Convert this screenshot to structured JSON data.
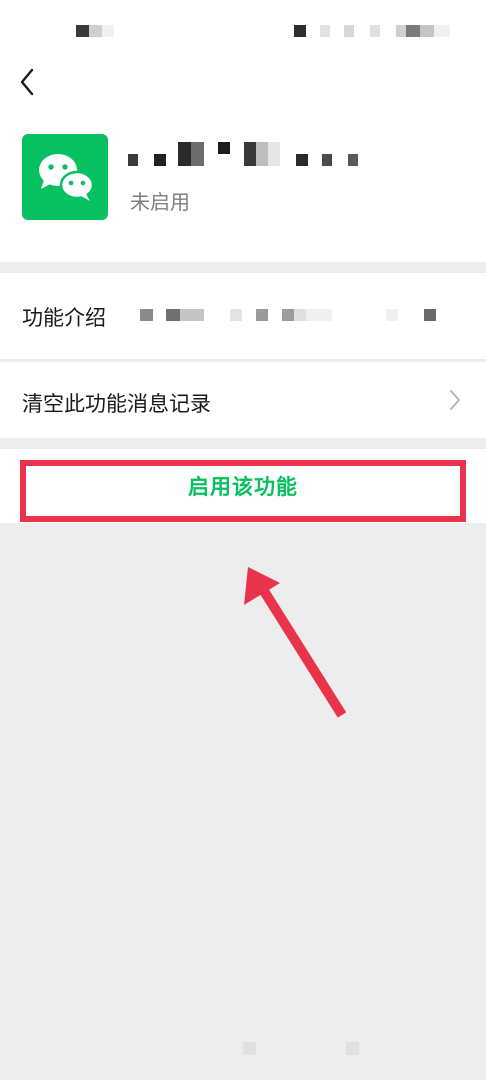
{
  "app": {
    "status": "未启用",
    "name_redacted": true,
    "icon": "wechat-logo-icon"
  },
  "header": {
    "back_icon": "back-chevron-icon"
  },
  "rows": {
    "intro_label": "功能介绍",
    "intro_value_redacted": true,
    "clear_label": "清空此功能消息记录",
    "clear_icon": "chevron-right-icon"
  },
  "action": {
    "enable_label": "启用该功能"
  },
  "annotation": {
    "highlight_color": "#e8334a",
    "arrow_icon": "pointer-arrow-icon"
  },
  "colors": {
    "accent": "#07c160",
    "background": "#ededed"
  }
}
